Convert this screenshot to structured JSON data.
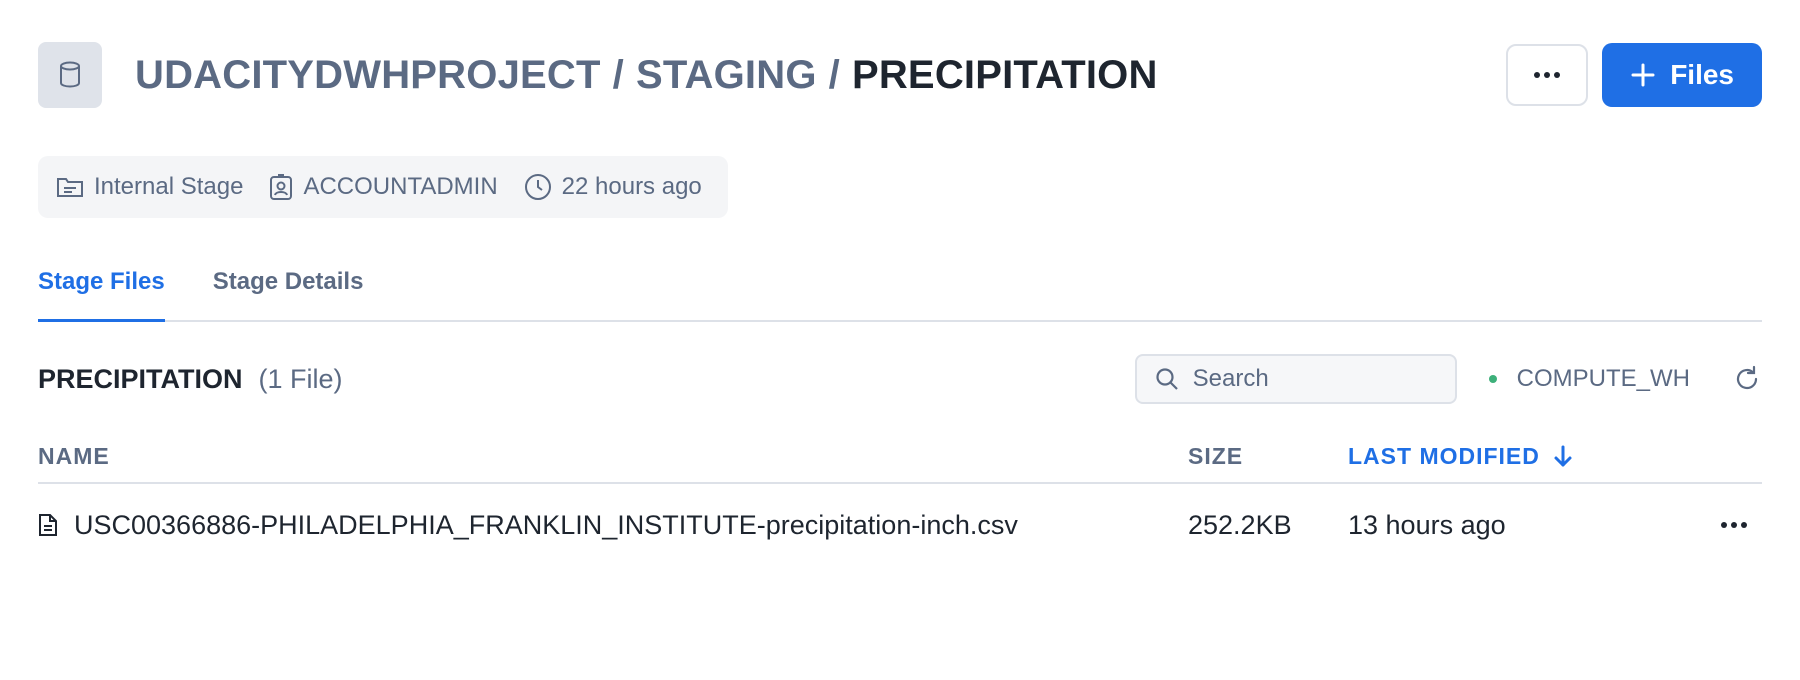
{
  "header": {
    "breadcrumb": {
      "database": "UDACITYDWHPROJECT",
      "separator": "/",
      "schema": "STAGING",
      "stage": "PRECIPITATION"
    },
    "more_label": "More options",
    "files_button_label": "Files",
    "icon": "database-icon"
  },
  "meta": {
    "stage_type": "Internal Stage",
    "owner": "ACCOUNTADMIN",
    "created": "22 hours ago"
  },
  "tabs": [
    {
      "label": "Stage Files",
      "active": true
    },
    {
      "label": "Stage Details",
      "active": false
    }
  ],
  "section": {
    "title": "PRECIPITATION",
    "count": "(1 File)",
    "search_placeholder": "Search",
    "warehouse": "COMPUTE_WH"
  },
  "table": {
    "columns": {
      "name": "NAME",
      "size": "SIZE",
      "modified": "LAST MODIFIED"
    },
    "rows": [
      {
        "name": "USC00366886-PHILADELPHIA_FRANKLIN_INSTITUTE-precipitation-inch.csv",
        "size": "252.2KB",
        "modified": "13 hours ago"
      }
    ]
  },
  "colors": {
    "accent": "#1f6fe5",
    "muted_text": "#5b6a83",
    "text": "#1e252f",
    "status_green": "#3db07a"
  }
}
